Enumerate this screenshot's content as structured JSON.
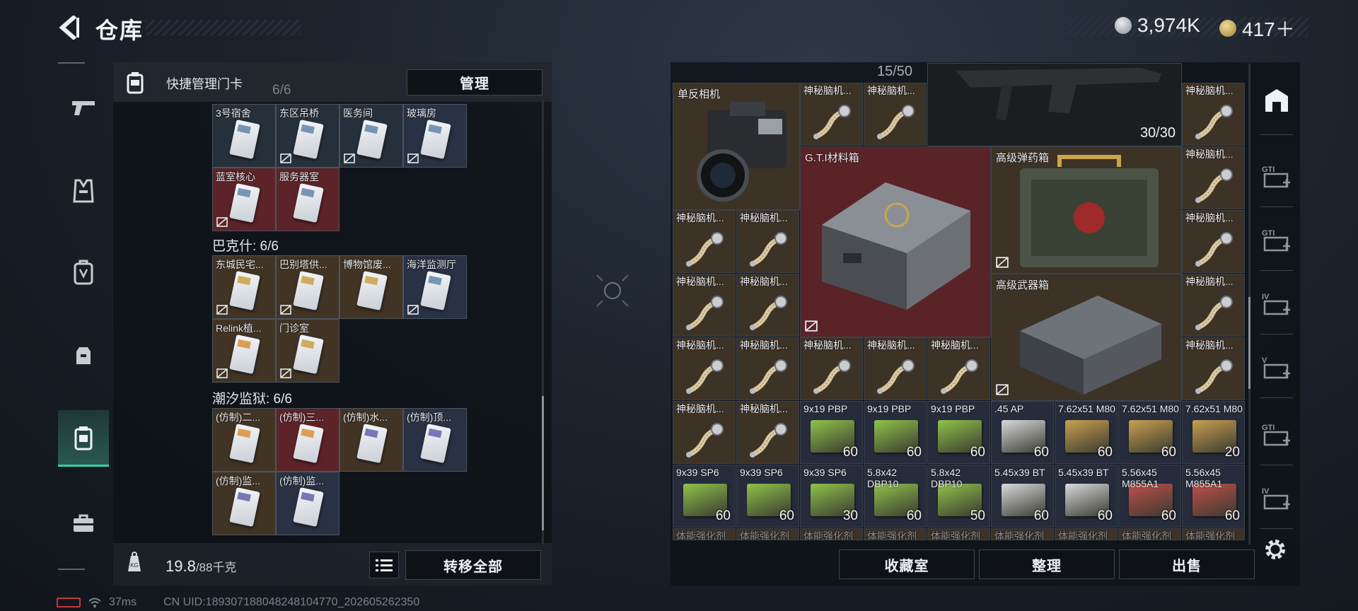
{
  "header": {
    "title": "仓库",
    "currency": [
      {
        "icon": "silver-coin-icon",
        "value": "3,974K"
      },
      {
        "icon": "gold-coin-icon",
        "value": "417＋"
      }
    ]
  },
  "left_panel": {
    "header_text": "快捷管理门卡",
    "manage_label": "管理",
    "partial_count": "6/6",
    "groups": [
      {
        "label": "",
        "cards": [
          {
            "name": "3号宿舍",
            "bg": "#26303b",
            "locked": false,
            "card": "blue"
          },
          {
            "name": "东区吊桥",
            "bg": "#26303b",
            "locked": true,
            "card": "blue"
          },
          {
            "name": "医务间",
            "bg": "#26303b",
            "locked": true,
            "card": "blue"
          },
          {
            "name": "玻璃房",
            "bg": "#283244",
            "locked": true,
            "card": "blue"
          },
          {
            "name": "蓝室核心",
            "bg": "#5c2428",
            "locked": true,
            "card": "blue"
          },
          {
            "name": "服务器室",
            "bg": "#5c2428",
            "locked": false,
            "card": "blue"
          }
        ]
      },
      {
        "label": "巴克什: 6/6",
        "cards": [
          {
            "name": "东城民宅...",
            "bg": "#413425",
            "locked": true,
            "card": "gold"
          },
          {
            "name": "巴别塔供...",
            "bg": "#413425",
            "locked": true,
            "card": "gold"
          },
          {
            "name": "博物馆废...",
            "bg": "#413425",
            "locked": false,
            "card": "gold"
          },
          {
            "name": "海洋监测厅",
            "bg": "#283244",
            "locked": true,
            "card": "blue"
          },
          {
            "name": "Relink植...",
            "bg": "#413425",
            "locked": true,
            "card": "orange"
          },
          {
            "name": "门诊室",
            "bg": "#413425",
            "locked": true,
            "card": "gold"
          }
        ]
      },
      {
        "label": "潮汐监狱: 6/6",
        "cards": [
          {
            "name": "(仿制)二...",
            "bg": "#413425",
            "locked": false,
            "card": "orange"
          },
          {
            "name": "(仿制)三...",
            "bg": "#5c2428",
            "locked": false,
            "card": "orange"
          },
          {
            "name": "(仿制)水...",
            "bg": "#413425",
            "locked": false,
            "card": "purple"
          },
          {
            "name": "(仿制)顶...",
            "bg": "#283244",
            "locked": false,
            "card": "purple"
          },
          {
            "name": "(仿制)监...",
            "bg": "#413425",
            "locked": false,
            "card": "purple"
          },
          {
            "name": "(仿制)监...",
            "bg": "#283244",
            "locked": false,
            "card": "purple"
          }
        ]
      }
    ],
    "weight_value": "19.8",
    "weight_max": "/88千克",
    "transfer_all_label": "转移全部"
  },
  "status": {
    "ping": "37ms",
    "uid": "CN UID:189307188048248104770_202605262350"
  },
  "right_panel": {
    "capacity": "15/50",
    "big_items": [
      {
        "name": "单反相机",
        "kind": "camera",
        "count": "",
        "locked": false
      },
      {
        "name": "G.T.I材料箱",
        "kind": "crate",
        "count": "",
        "locked": true
      },
      {
        "name": "高级弹药箱",
        "kind": "ammobox",
        "count": "",
        "locked": true
      },
      {
        "name": "高级武器箱",
        "kind": "weaponbox",
        "count": "",
        "locked": true
      },
      {
        "name": "",
        "kind": "rifle",
        "count": "30/30",
        "locked": false
      }
    ],
    "chip_name": "神秘脑机...",
    "ammo": [
      {
        "name": "9x19 PBP",
        "count": "60",
        "color": "#8fc34a"
      },
      {
        "name": "9x19 PBP",
        "count": "60",
        "color": "#8fc34a"
      },
      {
        "name": "9x19 PBP",
        "count": "60",
        "color": "#8fc34a"
      },
      {
        "name": ".45 AP",
        "count": "60",
        "color": "#d8dadc"
      },
      {
        "name": "7.62x51 M80",
        "count": "60",
        "color": "#c8a050"
      },
      {
        "name": "7.62x51 M80",
        "count": "60",
        "color": "#c8a050"
      },
      {
        "name": "7.62x51 M80",
        "count": "20",
        "color": "#c8a050"
      },
      {
        "name": "9x39 SP6",
        "count": "60",
        "color": "#8fc34a"
      },
      {
        "name": "9x39 SP6",
        "count": "60",
        "color": "#8fc34a"
      },
      {
        "name": "9x39 SP6",
        "count": "30",
        "color": "#8fc34a"
      },
      {
        "name": "5.8x42 DBP10",
        "count": "60",
        "color": "#8fc34a"
      },
      {
        "name": "5.8x42 DBP10",
        "count": "50",
        "color": "#8fc34a"
      },
      {
        "name": "5.45x39 BT",
        "count": "60",
        "color": "#d8dadc"
      },
      {
        "name": "5.45x39 BT",
        "count": "60",
        "color": "#d8dadc"
      },
      {
        "name": "5.56x45 M855A1",
        "count": "60",
        "color": "#c0504a"
      },
      {
        "name": "5.56x45 M855A1",
        "count": "60",
        "color": "#c0504a"
      }
    ],
    "bottom_row_label": "体能强化剂",
    "buttons": {
      "collection": "收藏室",
      "sort": "整理",
      "sell": "出售"
    }
  },
  "right_sidebar": {
    "labels": [
      "GTI",
      "GTI",
      "IV",
      "V",
      "GTI",
      "IV"
    ]
  }
}
